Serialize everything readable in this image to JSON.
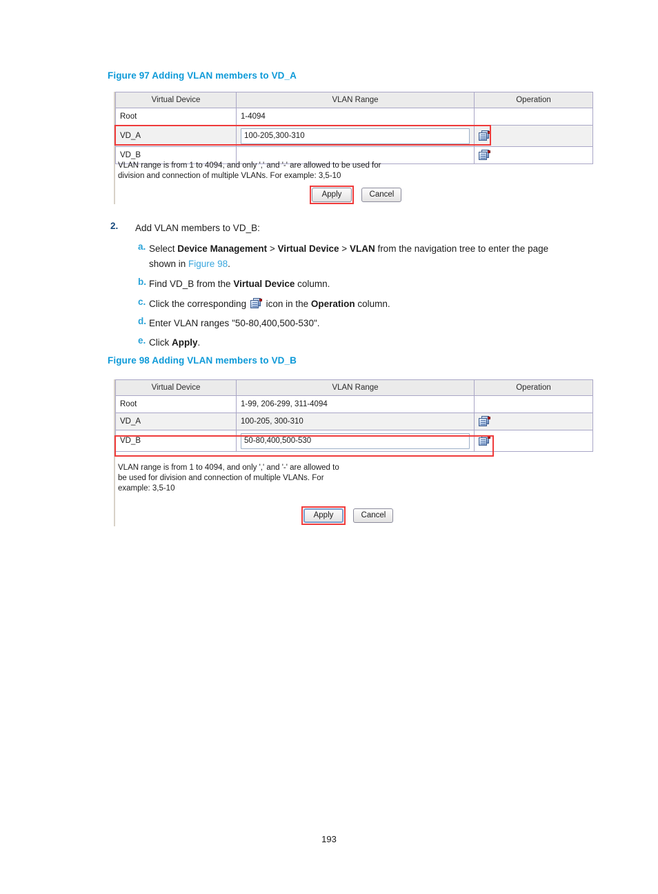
{
  "document": {
    "page_number": "193",
    "accent_caption_color": "#0e9ad8",
    "link_color": "#39a6dd",
    "step_number_color": "#16497d",
    "sub_letter_color": "#2aa3d8",
    "highlight_color": "#ef3b3b"
  },
  "figure97": {
    "caption": "Figure 97 Adding VLAN members to VD_A",
    "table": {
      "headers": [
        "Virtual Device",
        "VLAN Range",
        "Operation"
      ],
      "rows": [
        {
          "virtual_device": "Root",
          "vlan_range": "1-4094",
          "editable": false,
          "has_operation_icon": false
        },
        {
          "virtual_device": "VD_A",
          "vlan_range": "100-205,300-310",
          "editable": true,
          "has_operation_icon": true
        },
        {
          "virtual_device": "VD_B",
          "vlan_range": "",
          "editable": false,
          "has_operation_icon": true
        }
      ]
    },
    "hint": "VLAN range is from 1 to 4094, and only ',' and '-' are allowed to be used for\ndivision and connection of multiple VLANs. For example: 3,5-10",
    "buttons": {
      "apply": "Apply",
      "cancel": "Cancel"
    },
    "operation_icon_name": "edit-vlan-icon"
  },
  "figure98": {
    "caption": "Figure 98 Adding VLAN members to VD_B",
    "table": {
      "headers": [
        "Virtual Device",
        "VLAN Range",
        "Operation"
      ],
      "rows": [
        {
          "virtual_device": "Root",
          "vlan_range": "1-99, 206-299, 311-4094",
          "editable": false,
          "has_operation_icon": false
        },
        {
          "virtual_device": "VD_A",
          "vlan_range": "100-205, 300-310",
          "editable": false,
          "has_operation_icon": true
        },
        {
          "virtual_device": "VD_B",
          "vlan_range": "50-80,400,500-530",
          "editable": true,
          "has_operation_icon": true
        }
      ]
    },
    "hint": "VLAN range is from 1 to 4094, and only ',' and '-' are allowed to\nbe used for division and connection of multiple VLANs. For\nexample: 3,5-10",
    "buttons": {
      "apply": "Apply",
      "cancel": "Cancel"
    },
    "operation_icon_name": "edit-vlan-icon"
  },
  "procedure": {
    "step": {
      "marker": "2.",
      "title": "Add VLAN members to VD_B:"
    },
    "substeps": [
      {
        "marker": "a.",
        "line1_pre": "Select ",
        "b1": "Device Management",
        "sep1": " > ",
        "b2": "Virtual Device",
        "sep2": " > ",
        "b3": "VLAN",
        "line1_post": " from the navigation tree to enter the page",
        "line2_pre": "shown in ",
        "link": "Figure 98",
        "line2_post": "."
      },
      {
        "marker": "b.",
        "pre": "Find VD_B from the ",
        "bold": "Virtual Device",
        "post": " column."
      },
      {
        "marker": "c.",
        "pre": "Click the corresponding ",
        "icon": "edit-vlan-icon",
        "mid": " icon in the ",
        "bold": "Operation",
        "post": " column."
      },
      {
        "marker": "d.",
        "text": "Enter VLAN ranges \"50-80,400,500-530\"."
      },
      {
        "marker": "e.",
        "pre": "Click ",
        "bold": "Apply",
        "post": "."
      }
    ]
  }
}
